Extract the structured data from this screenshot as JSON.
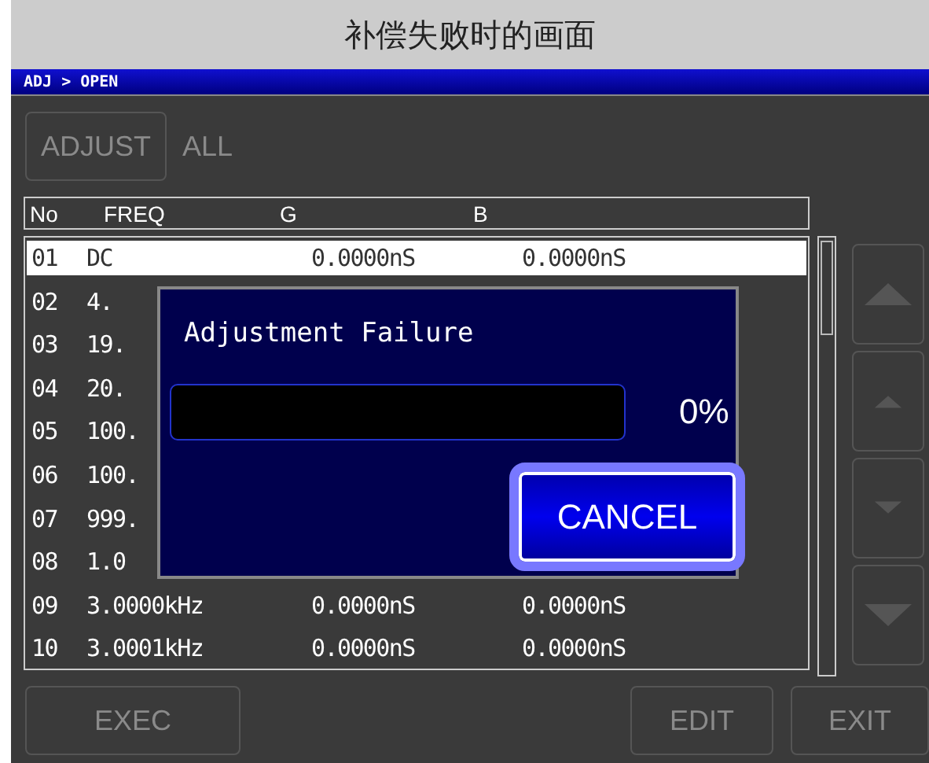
{
  "caption": "补偿失败时的画面",
  "breadcrumb": "ADJ > OPEN",
  "adjust_button": {
    "label": "ADJUST",
    "disabled": true
  },
  "mode_label": "ALL",
  "table": {
    "columns": [
      "No",
      "FREQ",
      "G",
      "B"
    ],
    "rows": [
      {
        "no": "01",
        "freq": "DC",
        "g": "0.0000nS",
        "b": "0.0000nS",
        "selected": true
      },
      {
        "no": "02",
        "freq": "4.",
        "selected": false
      },
      {
        "no": "03",
        "freq": "19.",
        "selected": false
      },
      {
        "no": "04",
        "freq": "20.",
        "selected": false
      },
      {
        "no": "05",
        "freq": "100.",
        "selected": false
      },
      {
        "no": "06",
        "freq": "100.",
        "selected": false
      },
      {
        "no": "07",
        "freq": "999.",
        "selected": false
      },
      {
        "no": "08",
        "freq": "1.0",
        "selected": false
      },
      {
        "no": "09",
        "freq": "3.0000kHz",
        "g": "0.0000nS",
        "b": "0.0000nS",
        "selected": false
      },
      {
        "no": "10",
        "freq": "3.0001kHz",
        "g": "0.0000nS",
        "b": "0.0000nS",
        "selected": false
      }
    ]
  },
  "footer_buttons": [
    {
      "label": "EXEC",
      "disabled": true
    },
    {
      "label": "EDIT",
      "disabled": true
    },
    {
      "label": "EXIT",
      "disabled": true
    }
  ],
  "dialog": {
    "title": "Adjustment Failure",
    "progress": {
      "level": 0,
      "reading": "0%"
    },
    "button": {
      "label": "CANCEL",
      "focused": true
    }
  }
}
